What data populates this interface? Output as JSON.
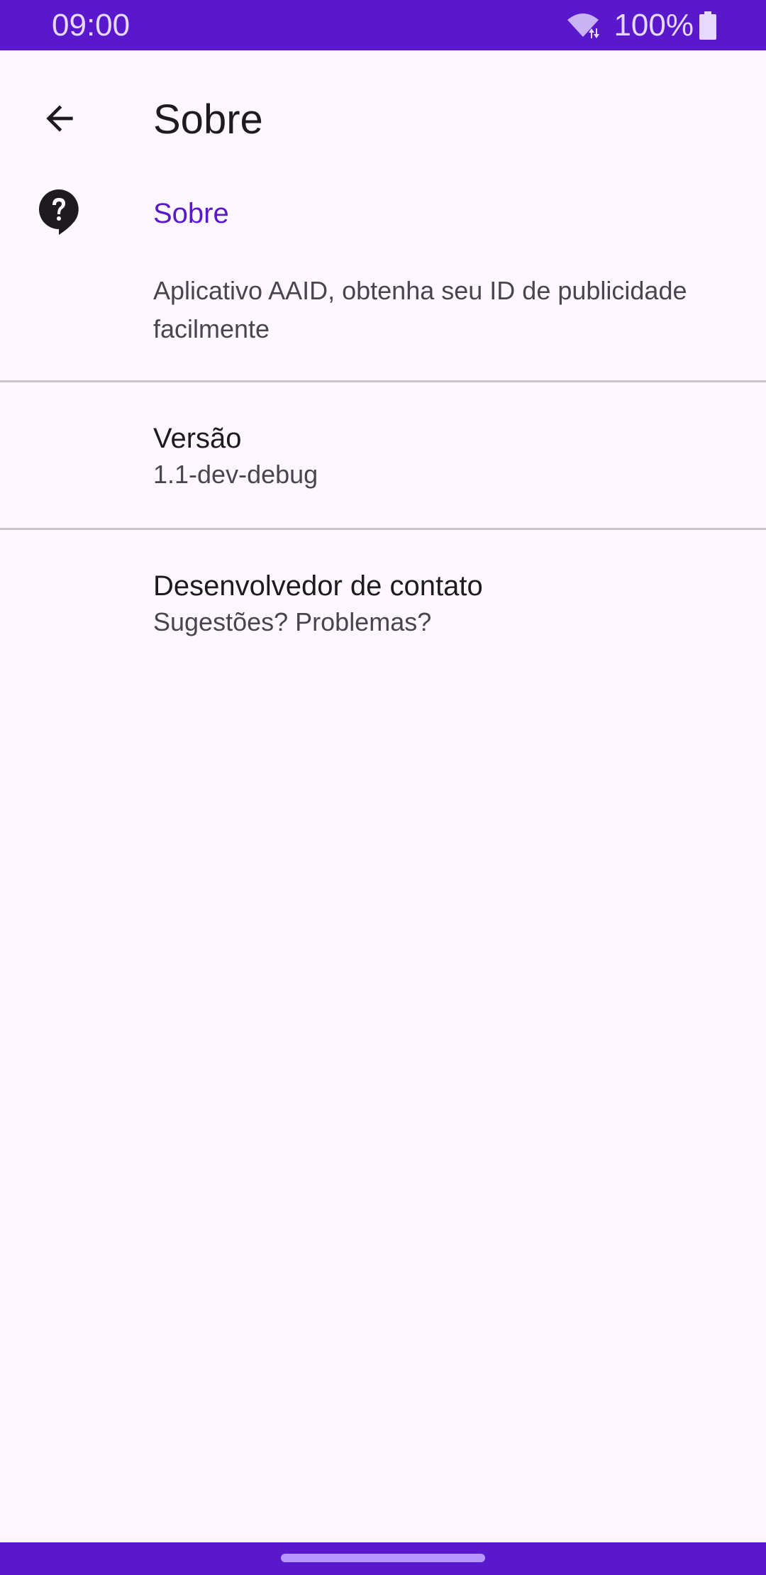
{
  "status_bar": {
    "time": "09:00",
    "battery": "100%",
    "icons": [
      "wifi-icon",
      "battery-icon"
    ],
    "color": "#5A18CC"
  },
  "top_bar": {
    "title": "Sobre",
    "back_icon": "arrow-back-icon"
  },
  "about": {
    "icon": "help-icon",
    "category_title": "Sobre",
    "summary": "Aplicativo AAID, obtenha seu ID de publicidade facilmente"
  },
  "preferences": [
    {
      "title": "Versão",
      "summary": "1.1-dev-debug"
    },
    {
      "title": "Desenvolvedor de contato",
      "summary": "Sugestões? Problemas?"
    }
  ],
  "colors": {
    "accent": "#5A18CC",
    "background": "#FEF7FF",
    "text_primary": "#1D1B20",
    "text_secondary": "#49454F",
    "divider": "#CAC4D0"
  }
}
